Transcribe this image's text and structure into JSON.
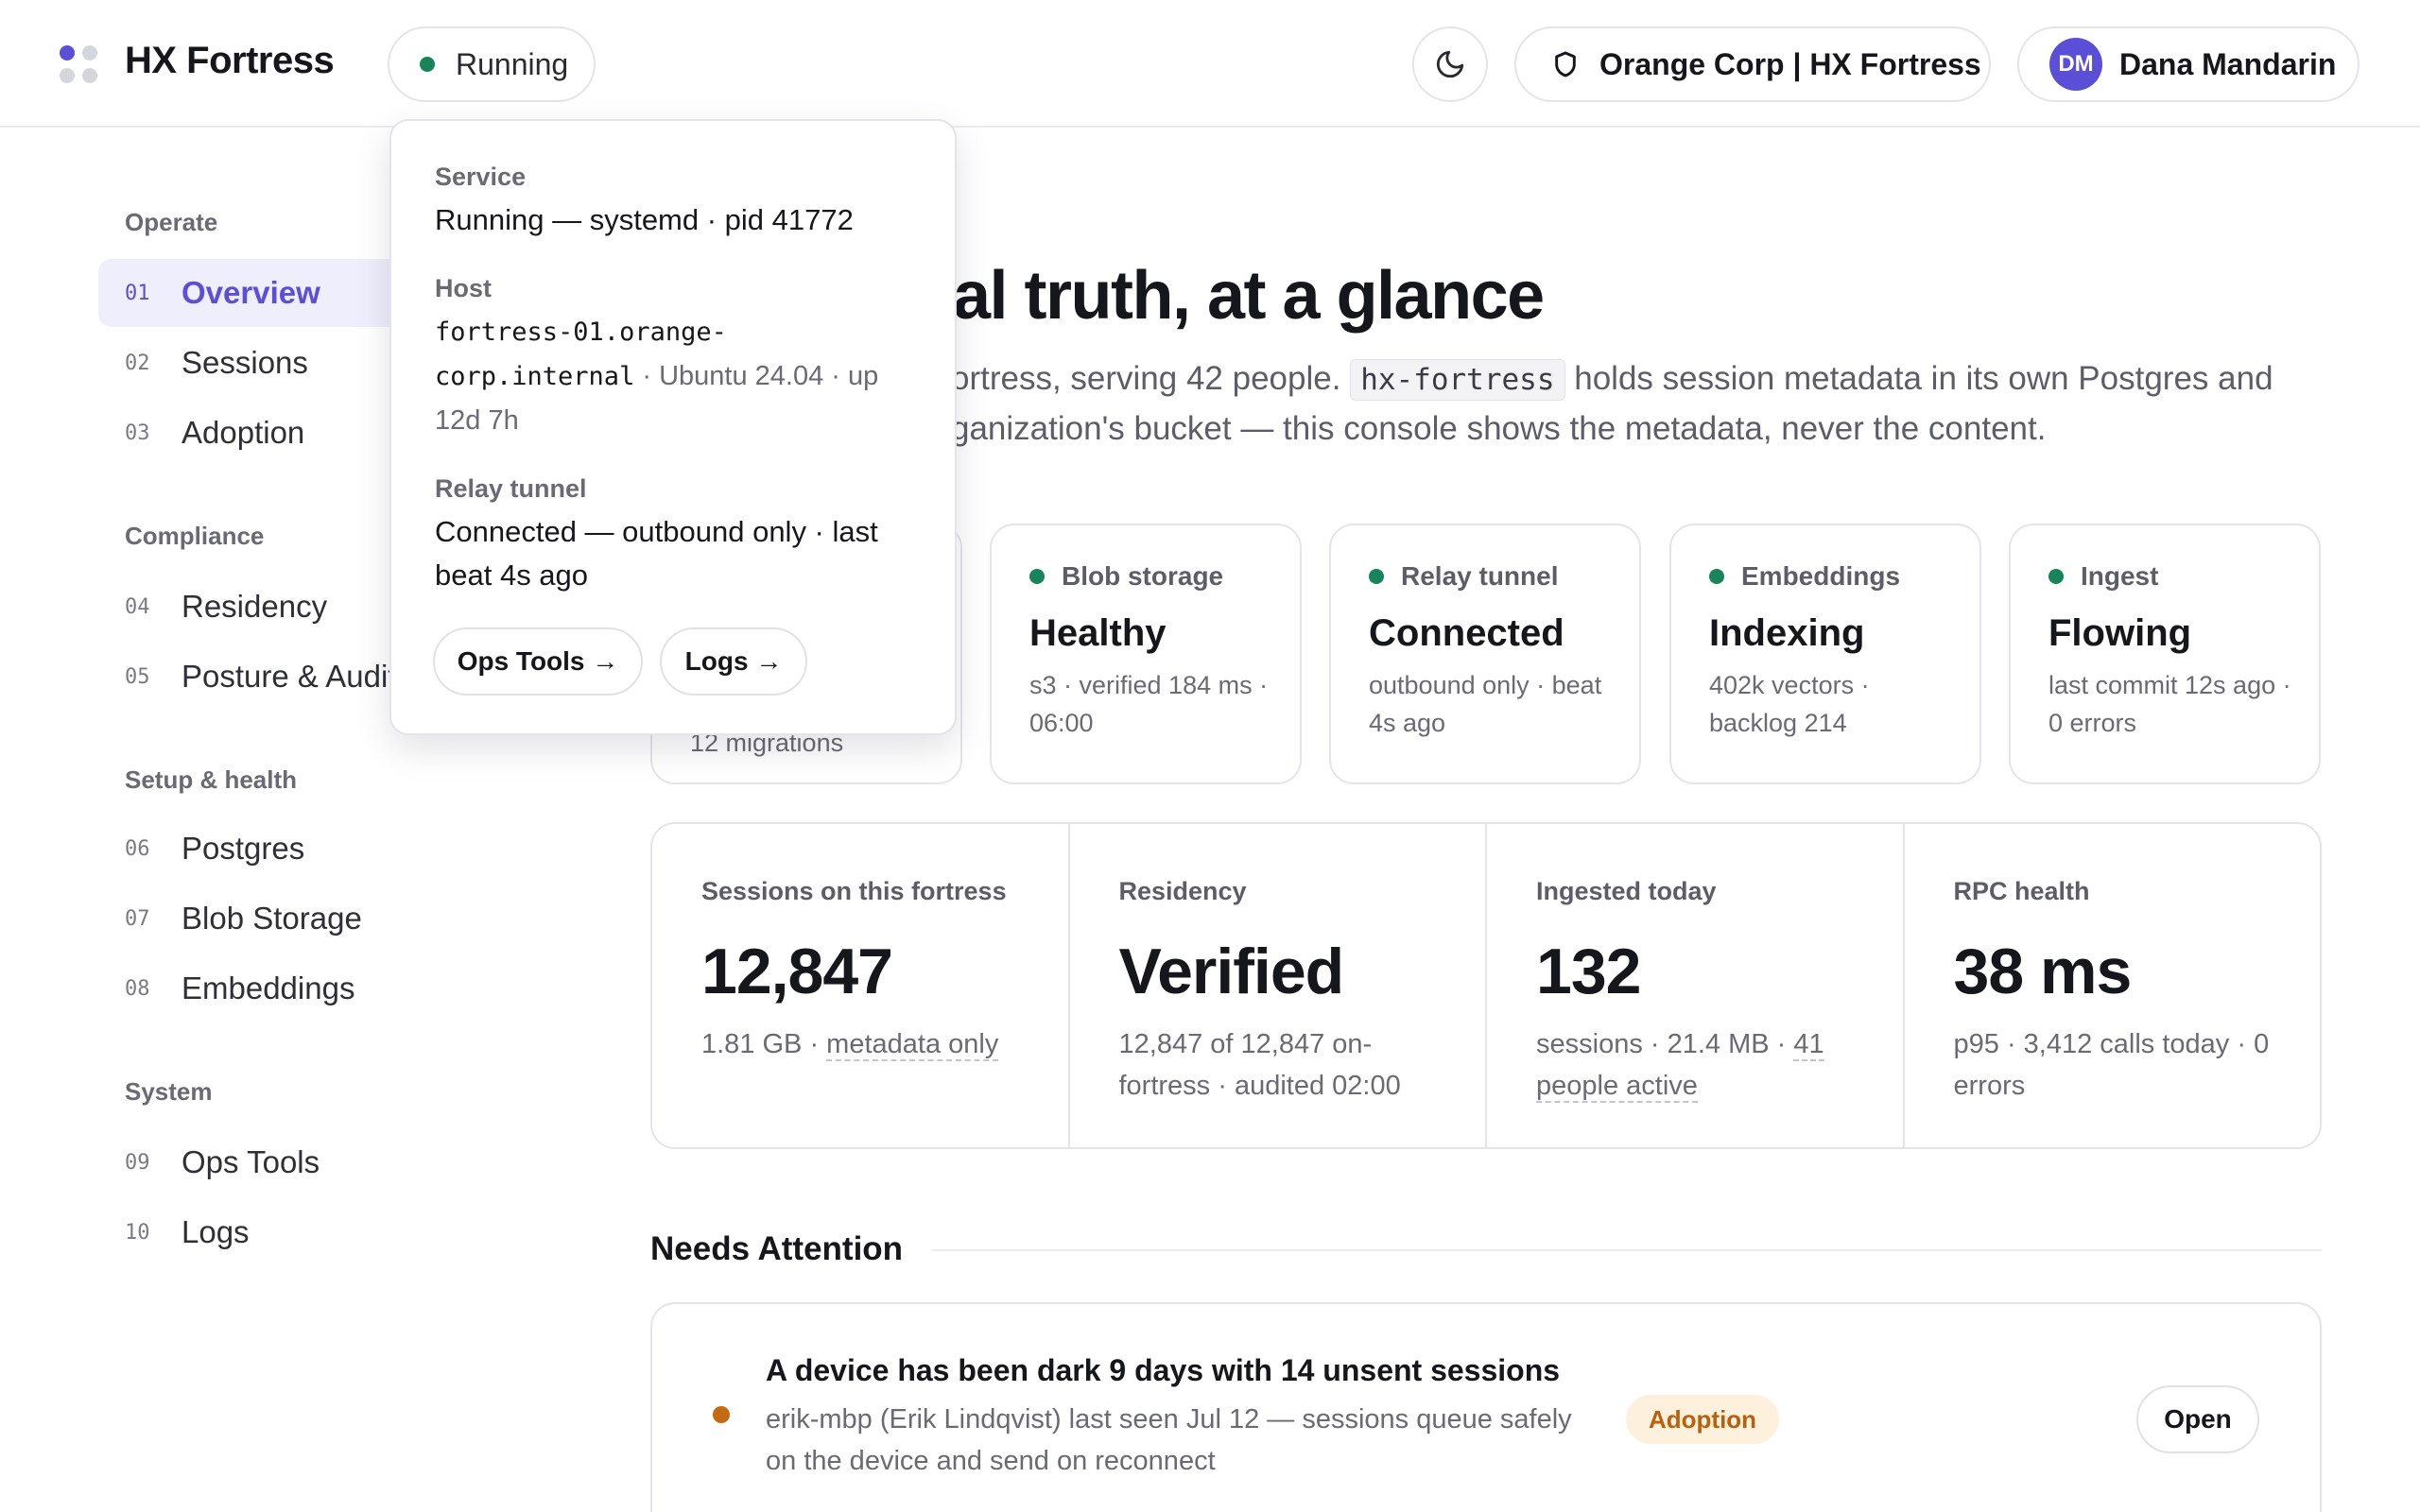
{
  "header": {
    "brand": "HX Fortress",
    "status": "Running",
    "theme_icon": "moon-icon",
    "org": "Orange Corp | HX Fortress",
    "user_initials": "DM",
    "user_name": "Dana Mandarin"
  },
  "sidebar": {
    "sections": [
      {
        "title": "Operate"
      },
      {
        "title": "Compliance"
      },
      {
        "title": "Setup & health"
      },
      {
        "title": "System"
      }
    ],
    "items": [
      {
        "num": "01",
        "label": "Overview"
      },
      {
        "num": "02",
        "label": "Sessions"
      },
      {
        "num": "03",
        "label": "Adoption"
      },
      {
        "num": "04",
        "label": "Residency"
      },
      {
        "num": "05",
        "label": "Posture & Audit"
      },
      {
        "num": "06",
        "label": "Postgres"
      },
      {
        "num": "07",
        "label": "Blob Storage"
      },
      {
        "num": "08",
        "label": "Embeddings"
      },
      {
        "num": "09",
        "label": "Ops Tools"
      },
      {
        "num": "10",
        "label": "Logs"
      }
    ],
    "active": "Overview"
  },
  "hero": {
    "title": "al truth, at a glance",
    "line1_a": "ortress, serving 42 people.",
    "code": "hx-fortress",
    "line1_b": "holds session metadata in its own Postgres and",
    "line2": "ganization's bucket — this console shows the metadata, never the content."
  },
  "health_cards": [
    {
      "label": "",
      "value": "",
      "sub": "12 migrations"
    },
    {
      "label": "Blob storage",
      "value": "Healthy",
      "sub": "s3 · verified 184 ms · 06:00"
    },
    {
      "label": "Relay tunnel",
      "value": "Connected",
      "sub": "outbound only · beat 4s ago"
    },
    {
      "label": "Embeddings",
      "value": "Indexing",
      "sub": "402k vectors · backlog 214"
    },
    {
      "label": "Ingest",
      "value": "Flowing",
      "sub": "last commit 12s ago · 0 errors"
    }
  ],
  "stats": [
    {
      "label": "Sessions on this fortress",
      "value": "12,847",
      "sub_a": "1.81 GB · ",
      "sub_b": "metadata only"
    },
    {
      "label": "Residency",
      "value": "Verified",
      "sub_a": "12,847 of 12,847 on-fortress · audited 02:00",
      "sub_b": ""
    },
    {
      "label": "Ingested today",
      "value": "132",
      "sub_a": "sessions · 21.4 MB · ",
      "sub_b": "41 people active"
    },
    {
      "label": "RPC health",
      "value": "38 ms",
      "sub_a": "p95 · 3,412 calls today · 0 errors",
      "sub_b": ""
    }
  ],
  "needs_attention": {
    "title": "Needs Attention",
    "items": [
      {
        "title": "A device has been dark 9 days with 14 unsent sessions",
        "desc": "erik-mbp (Erik Lindqvist) last seen Jul 12 — sessions queue safely on the device and send on reconnect",
        "tag": "Adoption",
        "action": "Open"
      }
    ]
  },
  "popover": {
    "service_label": "Service",
    "service_value": "Running — systemd · pid 41772",
    "host_label": "Host",
    "host_name": "fortress-01.orange-corp.internal",
    "host_meta": " · Ubuntu 24.04 · up 12d 7h",
    "relay_label": "Relay tunnel",
    "relay_value": "Connected — outbound only · last beat 4s ago",
    "btn_ops": "Ops Tools →",
    "btn_logs": "Logs →"
  },
  "colors": {
    "accent": "#5b4fd8",
    "healthy": "#17845a",
    "warning": "#c56a10",
    "tag_bg": "#fdf0dd"
  }
}
